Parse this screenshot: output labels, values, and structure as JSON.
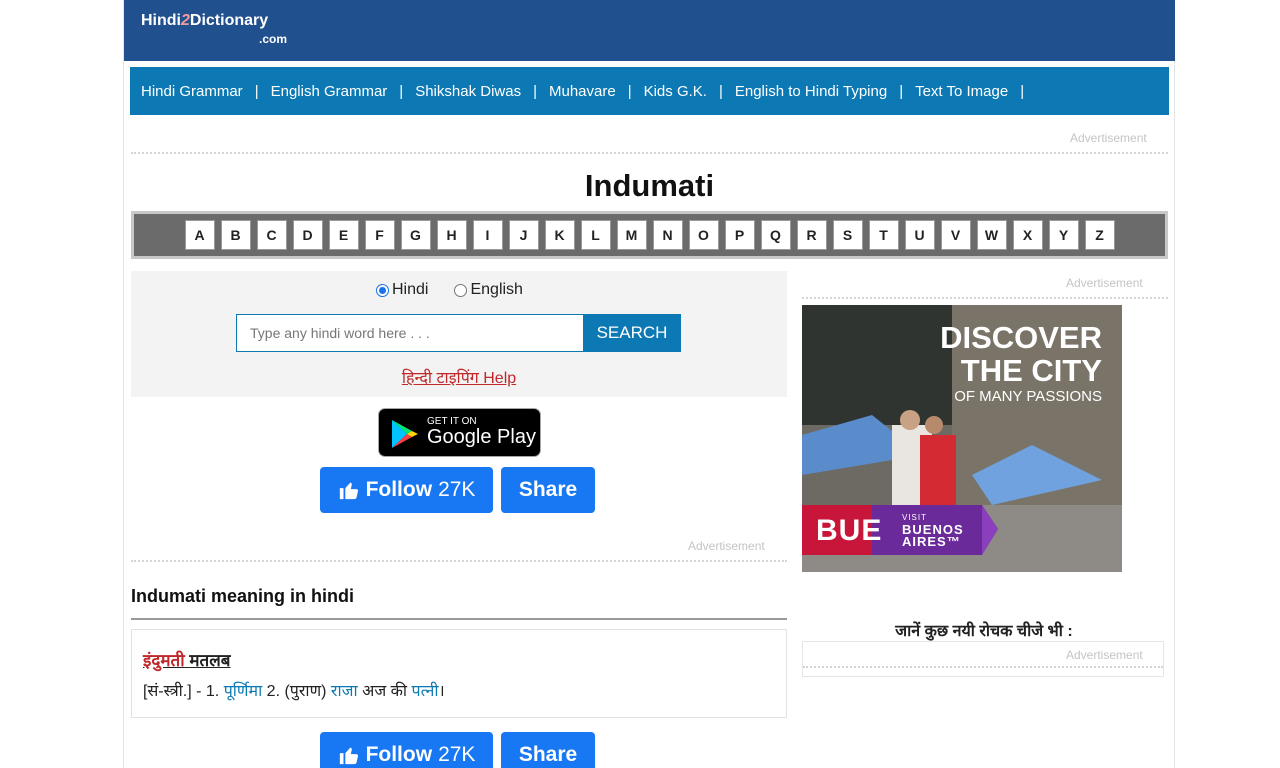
{
  "header": {
    "logo_main": "Hindi",
    "logo_two": "2",
    "logo_rest": "Dictionary",
    "logo_com": ".com"
  },
  "nav": {
    "items": [
      "Hindi Grammar",
      "English Grammar",
      "Shikshak Diwas",
      "Muhavare",
      "Kids G.K.",
      "English to Hindi Typing",
      "Text To Image"
    ],
    "separator": "|"
  },
  "ads": {
    "label": "Advertisement"
  },
  "page_title": "Indumati",
  "alphabet": [
    "A",
    "B",
    "C",
    "D",
    "E",
    "F",
    "G",
    "H",
    "I",
    "J",
    "K",
    "L",
    "M",
    "N",
    "O",
    "P",
    "Q",
    "R",
    "S",
    "T",
    "U",
    "V",
    "W",
    "X",
    "Y",
    "Z"
  ],
  "search": {
    "radio_hindi": "Hindi",
    "radio_english": "English",
    "selected": "Hindi",
    "placeholder": "Type any hindi word here . . .",
    "value": "",
    "button": "SEARCH",
    "typing_help": "हिन्दी टाइपिंग Help"
  },
  "google_play": {
    "small": "GET IT ON",
    "big": "Google Play"
  },
  "social": {
    "follow_label": "Follow",
    "follow_count": "27K",
    "share_label": "Share"
  },
  "meaning": {
    "section_title": "Indumati meaning in hindi",
    "headword": "इंदुमती",
    "headword_suffix": "मतलब",
    "pos": "[सं-स्त्री.] - 1.",
    "link1": "पूर्णिमा",
    "part2": "2. (पुराण)",
    "link2": "राजा",
    "part3": "अज की",
    "link3": "पत्नी",
    "end": "।"
  },
  "side_ad": {
    "line1": "DISCOVER",
    "line2": "THE CITY",
    "line3": "OF MANY PASSIONS",
    "brand": "BUE",
    "visit": "VISIT",
    "city1": "BUENOS",
    "city2": "AIRES™"
  },
  "side_heading": "जानें कुछ नयी रोचक चीजे भी :",
  "colors": {
    "header": "#21508f",
    "nav": "#0d79b4",
    "accent_red": "#c0282b",
    "facebook": "#1877f2"
  }
}
